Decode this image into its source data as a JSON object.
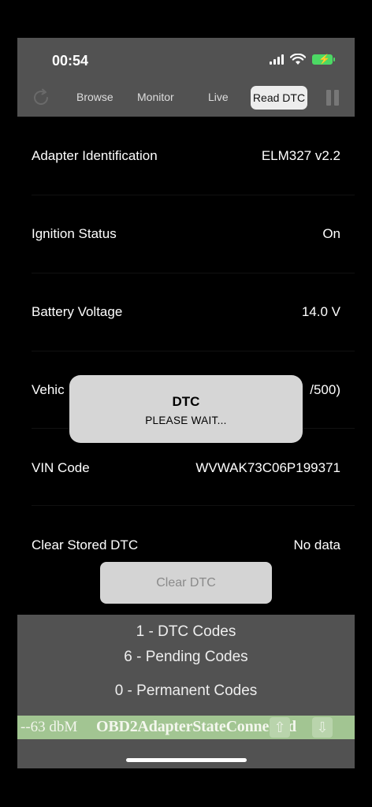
{
  "status_bar": {
    "time": "00:54"
  },
  "toolbar": {
    "tabs": [
      "Browse",
      "Monitor",
      "Live"
    ],
    "active_tab": "Read DTC"
  },
  "rows": [
    {
      "label": "Adapter Identification",
      "value": "ELM327 v2.2"
    },
    {
      "label": "Ignition Status",
      "value": "On"
    },
    {
      "label": "Battery Voltage",
      "value": "14.0 V"
    },
    {
      "label": "Vehic",
      "value": "/500)"
    },
    {
      "label": "VIN Code",
      "value": "WVWAK73C06P199371"
    },
    {
      "label": "Clear Stored DTC",
      "value": "No data"
    }
  ],
  "modal": {
    "title": "DTC",
    "message": "PLEASE WAIT..."
  },
  "clear_button": {
    "label": "Clear DTC"
  },
  "codes": {
    "dtc": "1 - DTC Codes",
    "pending": "6 - Pending Codes",
    "permanent": "0 - Permanent Codes"
  },
  "adapter_state": {
    "signal": "--63 dbM",
    "state": "OBD2AdapterStateConnected"
  },
  "colors": {
    "chrome": "#525252",
    "connected_bar": "#a2c592",
    "battery": "#4cd964"
  }
}
